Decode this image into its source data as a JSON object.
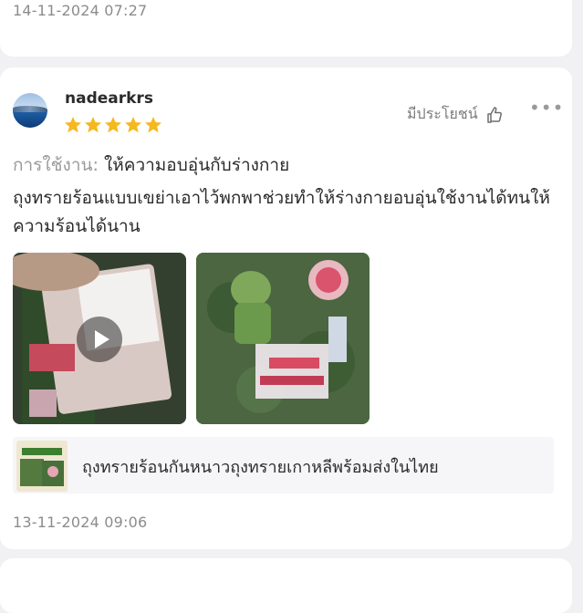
{
  "previous_review": {
    "date": "14-11-2024 07:27"
  },
  "review": {
    "username": "nadearkrs",
    "rating": 5,
    "helpful_label": "มีประโยชน์",
    "usage_label": "การใช้งาน:",
    "usage_value": "ให้ความอบอุ่นกับร่างกาย",
    "text": "ถุงทรายร้อนแบบเขย่าเอาไว้พกพาช่วยทำให้ร่างกายอบอุ่นใช้งานได้ทนให้ความร้อนได้นาน",
    "media": [
      {
        "type": "video",
        "icon": "play-icon"
      },
      {
        "type": "image"
      }
    ],
    "product_name": "ถุงทรายร้อนกันหนาวถุงทรายเกาหลีพร้อมส่งในไทย",
    "date": "13-11-2024 09:06"
  },
  "colors": {
    "star": "#f6b81f",
    "page_bg": "#f1f1f3",
    "card_bg": "#ffffff"
  }
}
